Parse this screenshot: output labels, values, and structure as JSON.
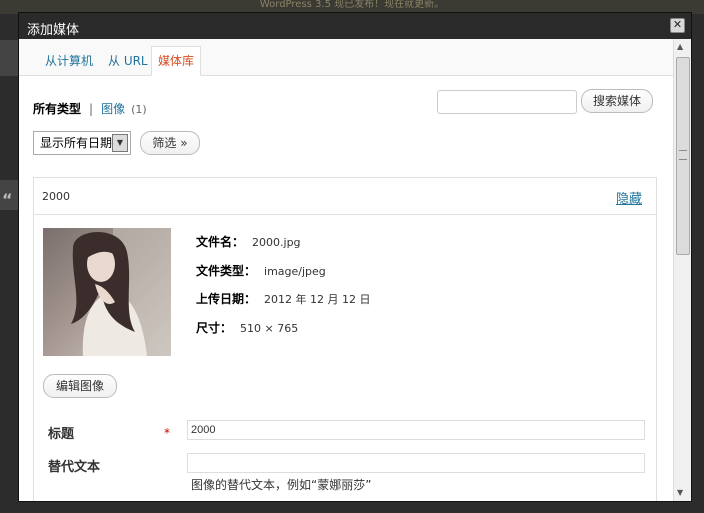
{
  "background": {
    "notice": "WordPress 3.5 现已发布！现在就更新。",
    "quote_glyph": "“"
  },
  "modal": {
    "title": "添加媒体",
    "close_glyph": "✕"
  },
  "tabs": [
    {
      "label": "从计算机",
      "active": false
    },
    {
      "label": "从 URL",
      "active": false
    },
    {
      "label": "媒体库",
      "active": true
    }
  ],
  "filters": {
    "all_label": "所有类型",
    "separator": "|",
    "image_label": "图像",
    "image_count": "(1)",
    "date_selected": "显示所有日期",
    "filter_button": "筛选 »"
  },
  "search": {
    "placeholder": "",
    "button_label": "搜索媒体"
  },
  "item": {
    "name": "2000",
    "hide_label": "隐藏",
    "file_name_label": "文件名：",
    "file_name": "2000.jpg",
    "file_type_label": "文件类型：",
    "file_type": "image/jpeg",
    "upload_date_label": "上传日期：",
    "upload_date": "2012 年 12 月 12 日",
    "dimensions_label": "尺寸：",
    "dimensions": "510 × 765",
    "edit_image_button": "编辑图像",
    "title_label": "标题",
    "required_mark": "*",
    "title_value": "2000",
    "alt_label": "替代文本",
    "alt_value": "",
    "alt_help": "图像的替代文本，例如“蒙娜丽莎”"
  },
  "colors": {
    "link": "#21759b",
    "active_tab": "#d54e21",
    "titlebar": "#2a2a2a"
  }
}
